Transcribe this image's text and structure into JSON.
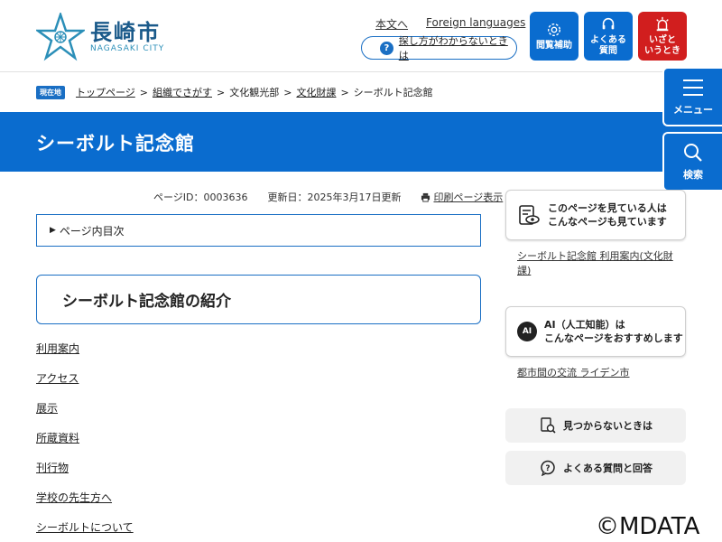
{
  "logo": {
    "name_jp": "長崎市",
    "name_en": "NAGASAKI CITY"
  },
  "header": {
    "links": [
      "本文へ",
      "Foreign languages"
    ],
    "help": "探し方がわからないときは",
    "buttons": [
      {
        "label": "閲覧補助",
        "icon": "gear-icon"
      },
      {
        "label": "よくある\n質問",
        "icon": "headset-icon"
      },
      {
        "label": "いざと\nいうとき",
        "icon": "siren-icon"
      }
    ]
  },
  "breadcrumb": {
    "badge": "現在地",
    "items": [
      "トップページ",
      "組織でさがす",
      "文化観光部",
      "文化財課",
      "シーボルト記念館"
    ],
    "sep": ">"
  },
  "page_title": "シーボルト記念館",
  "side": {
    "menu": "メニュー",
    "search": "検索"
  },
  "meta": {
    "page_id": "ページID：0003636",
    "updated": "更新日：2025年3月17日更新",
    "print": "印刷ページ表示"
  },
  "toc": {
    "label": "ページ内目次"
  },
  "section_title": "シーボルト記念館の紹介",
  "links": [
    "利用案内",
    "アクセス",
    "展示",
    "所蔵資料",
    "刊行物",
    "学校の先生方へ",
    "シーボルトについて"
  ],
  "right": {
    "box1": "このページを見ている人は\nこんなページも見ています",
    "link1": "シーボルト記念館 利用案内(文化財課)",
    "box2_badge": "AI",
    "box2": "AI（人工知能）は\nこんなページをおすすめします",
    "link2": "都市間の交流 ライデン市",
    "btn1": "見つからないときは",
    "btn2": "よくある質問と回答"
  },
  "watermark": "©MDATA",
  "colors": {
    "primary": "#0a6ccf",
    "alert": "#d11e1e",
    "logo": "#2b8fb8"
  }
}
